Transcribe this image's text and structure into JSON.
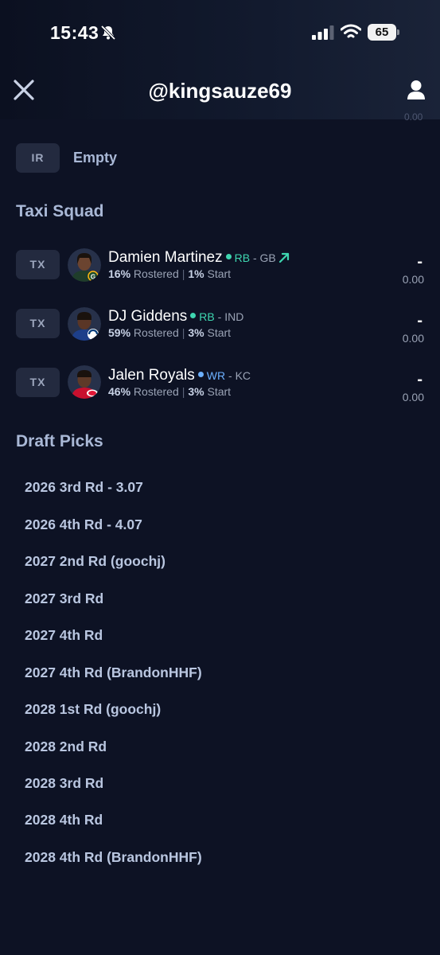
{
  "status_bar": {
    "time": "15:43",
    "battery": "65"
  },
  "header": {
    "title": "@kingsauze69",
    "partial_value": "0.00"
  },
  "ir": {
    "tag": "IR",
    "label": "Empty"
  },
  "taxi_squad": {
    "title": "Taxi Squad",
    "players": [
      {
        "tag": "TX",
        "name": "Damien Martinez",
        "position": "RB",
        "team": "GB",
        "rostered": "16%",
        "rostered_label": "Rostered",
        "start": "1%",
        "start_label": "Start",
        "score": "-",
        "points": "0.00",
        "trend": "up"
      },
      {
        "tag": "TX",
        "name": "DJ Giddens",
        "position": "RB",
        "team": "IND",
        "rostered": "59%",
        "rostered_label": "Rostered",
        "start": "3%",
        "start_label": "Start",
        "score": "-",
        "points": "0.00"
      },
      {
        "tag": "TX",
        "name": "Jalen Royals",
        "position": "WR",
        "team": "KC",
        "rostered": "46%",
        "rostered_label": "Rostered",
        "start": "3%",
        "start_label": "Start",
        "score": "-",
        "points": "0.00"
      }
    ]
  },
  "draft_picks": {
    "title": "Draft Picks",
    "items": [
      "2026 3rd Rd - 3.07",
      "2026 4th Rd - 4.07",
      "2027 2nd Rd (goochj)",
      "2027 3rd Rd",
      "2027 4th Rd",
      "2027 4th Rd (BrandonHHF)",
      "2028 1st Rd (goochj)",
      "2028 2nd Rd",
      "2028 3rd Rd",
      "2028 4th Rd",
      "2028 4th Rd (BrandonHHF)"
    ]
  },
  "colors": {
    "background": "#0d1224",
    "rb": "#3ed6b0",
    "wr": "#6cb0ff",
    "tag_bg": "#232a3f"
  },
  "icons": [
    "bell-slash-icon",
    "signal-icon",
    "wifi-icon",
    "battery-icon",
    "close-icon",
    "user-icon",
    "trend-up-icon"
  ]
}
